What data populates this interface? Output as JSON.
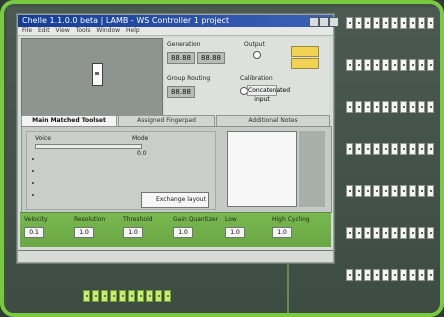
{
  "window": {
    "title": "Chelle 1.1.0.0 beta | LAMB - WS Controller 1 project"
  },
  "menu": [
    "File",
    "Edit",
    "View",
    "Tools",
    "Window",
    "Help"
  ],
  "panels": {
    "left_title": "",
    "right_labels": {
      "group1": "Generation",
      "group2": "Output",
      "group3": "Group Routing",
      "group4": "Calibration"
    },
    "digits": {
      "a": "88.88",
      "b": "88.88"
    },
    "buttons": {
      "b1": "",
      "b2": ""
    },
    "option_text": "Concatenated input"
  },
  "tabs": [
    "Main Matched Toolset",
    "Assigned Fingerpad",
    "Additional Notes"
  ],
  "work": {
    "left_label": "Voice",
    "mid_label": "Mode",
    "value_text": "0.0",
    "slider_box_label": "Exchange layout"
  },
  "bottom_fields": [
    {
      "label": "Velocity",
      "value": "0.1"
    },
    {
      "label": "Resolution",
      "value": "1.0"
    },
    {
      "label": "Threshold",
      "value": "1.0"
    },
    {
      "label": "Gain Quantizer",
      "value": "1.0"
    },
    {
      "label": "Low",
      "value": "1.0"
    },
    {
      "label": "High Cycling",
      "value": "1.0"
    }
  ]
}
